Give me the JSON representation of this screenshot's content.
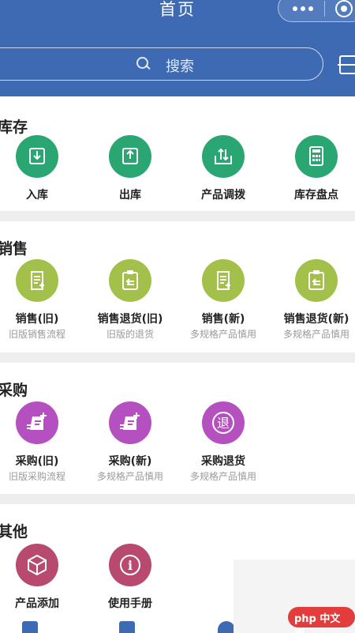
{
  "header": {
    "title": "首页"
  },
  "search": {
    "placeholder": "搜索"
  },
  "colors": {
    "header": "#3d6ab3",
    "green": "#2aa673",
    "olive": "#a3c04a",
    "purple": "#b550c0",
    "rose": "#b84a70"
  },
  "sections": {
    "inventory": {
      "title": "库存",
      "items": [
        {
          "label": "入库",
          "icon": "inbound-icon"
        },
        {
          "label": "出库",
          "icon": "outbound-icon"
        },
        {
          "label": "产品调拨",
          "icon": "transfer-icon"
        },
        {
          "label": "库存盘点",
          "icon": "stocktake-icon"
        }
      ]
    },
    "sales": {
      "title": "销售",
      "items": [
        {
          "label": "销售(旧)",
          "sub": "旧版销售流程",
          "icon": "sales-doc-icon"
        },
        {
          "label": "销售退货(旧)",
          "sub": "旧版的退货",
          "icon": "return-clipboard-icon"
        },
        {
          "label": "销售(新)",
          "sub": "多规格产品慎用",
          "icon": "sales-doc-icon"
        },
        {
          "label": "销售退货(新)",
          "sub": "多规格产品慎用",
          "icon": "return-clipboard-icon"
        }
      ]
    },
    "purchase": {
      "title": "采购",
      "items": [
        {
          "label": "采购(旧)",
          "sub": "旧版采购流程",
          "icon": "purchase-icon"
        },
        {
          "label": "采购(新)",
          "sub": "多规格产品慎用",
          "icon": "purchase-icon"
        },
        {
          "label": "采购退货",
          "sub": "多规格产品慎用",
          "icon": "return-circle-icon",
          "glyph": "退"
        }
      ]
    },
    "other": {
      "title": "其他",
      "items": [
        {
          "label": "产品添加",
          "icon": "box-icon"
        },
        {
          "label": "使用手册",
          "icon": "info-icon",
          "glyph": "i"
        }
      ]
    }
  },
  "watermark": {
    "text": "php 中文网"
  }
}
